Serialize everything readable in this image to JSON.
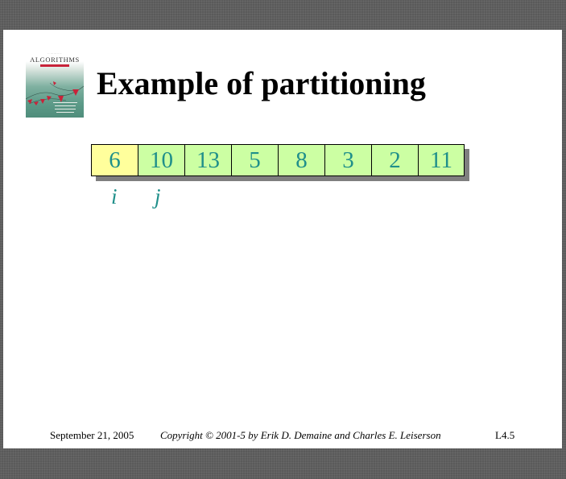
{
  "slide": {
    "title": "Example of partitioning",
    "book_cover": {
      "title": "ALGORITHMS",
      "accent_color": "#c8233a"
    },
    "array": {
      "cells": [
        "6",
        "10",
        "13",
        "5",
        "8",
        "3",
        "2",
        "11"
      ],
      "pivot_color": "#ffff9c",
      "cell_color": "#ccffa3",
      "text_color": "#1f8f8a"
    },
    "pointers": {
      "i": "i",
      "j": "j"
    },
    "footer": {
      "date": "September 21, 2005",
      "copyright": "Copyright © 2001-5 by Erik D. Demaine and Charles E. Leiserson",
      "page": "L4.5"
    }
  }
}
